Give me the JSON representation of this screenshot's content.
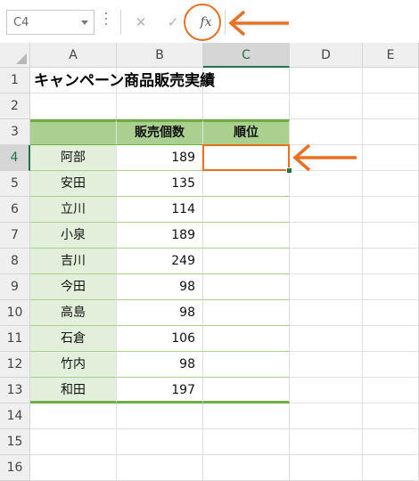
{
  "name_box": {
    "value": "C4"
  },
  "formula_bar": {
    "cancel_glyph": "✕",
    "enter_glyph": "✓",
    "fx_label": "fx",
    "value": ""
  },
  "columns": [
    "A",
    "B",
    "C",
    "D",
    "E"
  ],
  "selected_column": "C",
  "rows": [
    "1",
    "2",
    "3",
    "4",
    "5",
    "6",
    "7",
    "8",
    "9",
    "10",
    "11",
    "12",
    "13",
    "14",
    "15",
    "16"
  ],
  "selected_row": "4",
  "sheet": {
    "title": "キャンペーン商品販売実績",
    "headers": {
      "b": "販売個数",
      "c": "順位"
    },
    "data": [
      {
        "name": "阿部",
        "qty": "189",
        "rank": ""
      },
      {
        "name": "安田",
        "qty": "135",
        "rank": ""
      },
      {
        "name": "立川",
        "qty": "114",
        "rank": ""
      },
      {
        "name": "小泉",
        "qty": "189",
        "rank": ""
      },
      {
        "name": "吉川",
        "qty": "249",
        "rank": ""
      },
      {
        "name": "今田",
        "qty": "98",
        "rank": ""
      },
      {
        "name": "高島",
        "qty": "98",
        "rank": ""
      },
      {
        "name": "石倉",
        "qty": "106",
        "rank": ""
      },
      {
        "name": "竹内",
        "qty": "98",
        "rank": ""
      },
      {
        "name": "和田",
        "qty": "197",
        "rank": ""
      }
    ]
  },
  "colors": {
    "accent_orange": "#e87024",
    "header_green": "#a9d08e",
    "name_green": "#e2efda",
    "excel_green": "#217346"
  }
}
